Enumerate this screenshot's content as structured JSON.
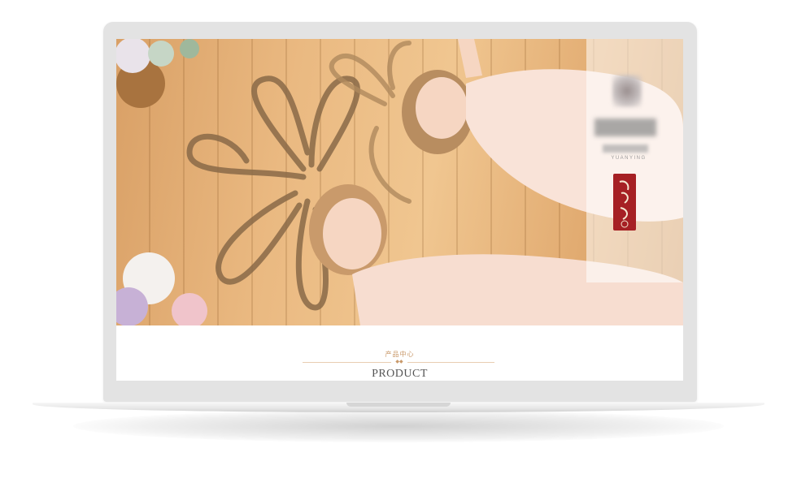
{
  "device": {
    "type": "laptop-mockup"
  },
  "hero": {
    "image_description_label": "photo",
    "brand": {
      "tagline": "YUANYING"
    }
  },
  "section": {
    "title_cn": "产品中心",
    "divider_ornament": "◆◆",
    "title_en": "PRODUCT"
  },
  "colors": {
    "accent": "#c9996a",
    "seal": "#a62024",
    "frame": "#e3e3e3"
  }
}
